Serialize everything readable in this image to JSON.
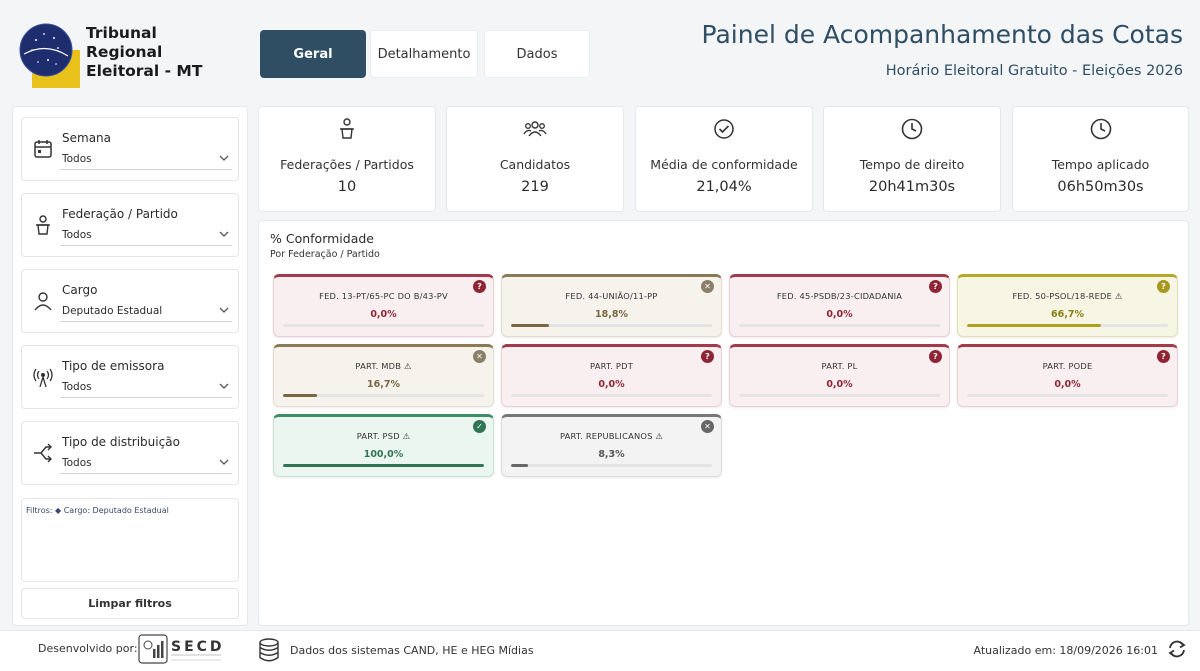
{
  "brand": {
    "logo_text": "Tribunal\nRegional\nEleitoral - MT"
  },
  "header": {
    "title": "Painel de Acompanhamento das Cotas",
    "subtitle": "Horário Eleitoral Gratuito - Eleições 2026"
  },
  "nav": {
    "tabs": [
      {
        "label": "Geral",
        "active": true
      },
      {
        "label": "Detalhamento",
        "active": false
      },
      {
        "label": "Dados",
        "active": false
      }
    ]
  },
  "filters": [
    {
      "label": "Semana",
      "value": "Todos",
      "icon": "calendar-icon"
    },
    {
      "label": "Federação / Partido",
      "value": "Todos",
      "icon": "podium-icon"
    },
    {
      "label": "Cargo",
      "value": "Deputado Estadual",
      "icon": "person-icon"
    },
    {
      "label": "Tipo de emissora",
      "value": "Todos",
      "icon": "antenna-icon"
    },
    {
      "label": "Tipo de distribuição",
      "value": "Todos",
      "icon": "split-arrow-icon"
    }
  ],
  "filters_summary": "Filtros: ◆ Cargo: Deputado Estadual",
  "clear_filters": "Limpar filtros",
  "kpis": [
    {
      "label": "Federações / Partidos",
      "value": "10",
      "icon": "podium-icon"
    },
    {
      "label": "Candidatos",
      "value": "219",
      "icon": "people-icon"
    },
    {
      "label": "Média de conformidade",
      "value": "21,04%",
      "icon": "check-circle-icon"
    },
    {
      "label": "Tempo de direito",
      "value": "20h41m30s",
      "icon": "clock-icon"
    },
    {
      "label": "Tempo aplicado",
      "value": "06h50m30s",
      "icon": "clock-icon"
    }
  ],
  "panel": {
    "title": "% Conformidade",
    "subtitle": "Por Federação / Partido"
  },
  "parties": [
    {
      "name": "FED. 13-PT/65-PC DO B/43-PV",
      "value": "0,0%",
      "percent": 0,
      "status": "low",
      "status_icon": "alert-icon",
      "glyph": "?"
    },
    {
      "name": "FED. 44-UNIÃO/11-PP",
      "value": "18,8%",
      "percent": 18.8,
      "status": "mid",
      "status_icon": "x-icon",
      "glyph": "✕"
    },
    {
      "name": "FED. 45-PSDB/23-CIDADANIA",
      "value": "0,0%",
      "percent": 0,
      "status": "low",
      "status_icon": "alert-icon",
      "glyph": "?"
    },
    {
      "name": "FED. 50-PSOL/18-REDE ⚠",
      "value": "66,7%",
      "percent": 66.7,
      "status": "ylw",
      "status_icon": "alert-icon",
      "glyph": "?"
    },
    {
      "name": "PART. MDB ⚠",
      "value": "16,7%",
      "percent": 16.7,
      "status": "mid",
      "status_icon": "x-icon",
      "glyph": "✕"
    },
    {
      "name": "PART. PDT",
      "value": "0,0%",
      "percent": 0,
      "status": "low",
      "status_icon": "alert-icon",
      "glyph": "?"
    },
    {
      "name": "PART. PL",
      "value": "0,0%",
      "percent": 0,
      "status": "low",
      "status_icon": "alert-icon",
      "glyph": "?"
    },
    {
      "name": "PART. PODE",
      "value": "0,0%",
      "percent": 0,
      "status": "low",
      "status_icon": "alert-icon",
      "glyph": "?"
    },
    {
      "name": "PART. PSD ⚠",
      "value": "100,0%",
      "percent": 100,
      "status": "ok",
      "status_icon": "check-icon",
      "glyph": "✓"
    },
    {
      "name": "PART. REPUBLICANOS ⚠",
      "value": "8,3%",
      "percent": 8.3,
      "status": "gray",
      "status_icon": "x-icon",
      "glyph": "✕"
    }
  ],
  "footer": {
    "developed_by": "Desenvolvido por:",
    "secd_logo_text": "SECD",
    "sources": "Dados dos sistemas CAND, HE e HEG Mídias",
    "updated": "Atualizado em: 18/09/2026 16:01"
  }
}
